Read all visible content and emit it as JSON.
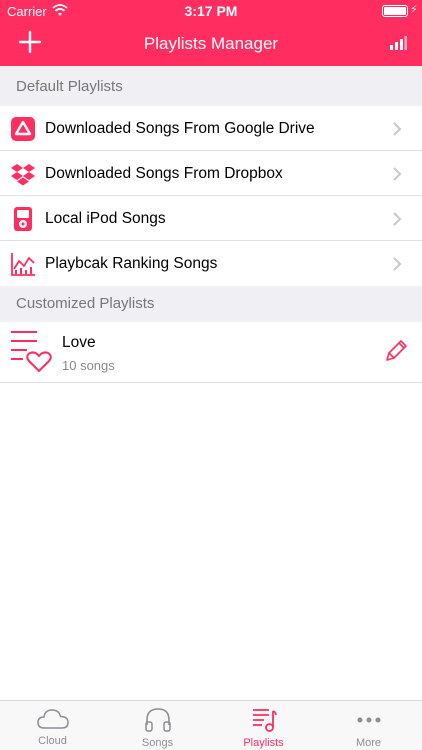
{
  "status": {
    "carrier": "Carrier",
    "time": "3:17 PM"
  },
  "nav": {
    "title": "Playlists Manager",
    "left_icon": "plus-icon",
    "right_icon": "bar-chart-icon"
  },
  "colors": {
    "accent": "#FF2D60",
    "section_bg": "#EFEFF4"
  },
  "default_section": {
    "title": "Default Playlists",
    "items": [
      {
        "label": "Downloaded Songs From Google Drive",
        "icon": "google-drive-icon"
      },
      {
        "label": "Downloaded Songs From Dropbox",
        "icon": "dropbox-icon"
      },
      {
        "label": "Local iPod Songs",
        "icon": "ipod-icon"
      },
      {
        "label": "Playbcak Ranking Songs",
        "icon": "ranking-chart-icon"
      }
    ]
  },
  "custom_section": {
    "title": "Customized Playlists",
    "items": [
      {
        "name": "Love",
        "count": "10 songs",
        "icon": "playlist-heart-icon",
        "action_icon": "pencil-icon"
      }
    ]
  },
  "tabs": [
    {
      "label": "Cloud",
      "icon": "cloud-icon",
      "active": false
    },
    {
      "label": "Songs",
      "icon": "headphones-icon",
      "active": false
    },
    {
      "label": "Playlists",
      "icon": "playlist-note-icon",
      "active": true
    },
    {
      "label": "More",
      "icon": "more-dots-icon",
      "active": false
    }
  ]
}
